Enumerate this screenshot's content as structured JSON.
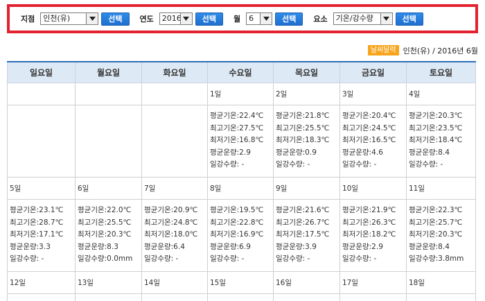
{
  "filters": {
    "station_label": "지점",
    "station_value": "인천(유)",
    "year_label": "연도",
    "year_value": "2016",
    "month_label": "월",
    "month_value": "6",
    "element_label": "요소",
    "element_value": "기온/강수량",
    "select_button": "선택"
  },
  "legend": {
    "badge": "날씨달력",
    "caption": "인천(유) / 2016년 6월"
  },
  "colors": {
    "highlight_border": "#e3222f",
    "button_blue": "#1f6fcf",
    "header_bg": "#dde9f4",
    "header_top_border": "#2a6db8",
    "badge_orange": "#f7a51c"
  },
  "calendar": {
    "weekdays": [
      "일요일",
      "월요일",
      "화요일",
      "수요일",
      "목요일",
      "금요일",
      "토요일"
    ],
    "weeks": [
      {
        "dates": [
          "",
          "",
          "",
          "1일",
          "2일",
          "3일",
          "4일"
        ],
        "stats": [
          null,
          null,
          null,
          [
            "평균기온:22.4℃",
            "최고기온:27.5℃",
            "최저기온:16.8℃",
            "평균운량:2.9",
            "일강수량: -"
          ],
          [
            "평균기온:21.8℃",
            "최고기온:25.5℃",
            "최저기온:18.3℃",
            "평균운량:0.9",
            "일강수량: -"
          ],
          [
            "평균기온:20.4℃",
            "최고기온:24.5℃",
            "최저기온:16.5℃",
            "평균운량:4.6",
            "일강수량: -"
          ],
          [
            "평균기온:20.3℃",
            "최고기온:23.5℃",
            "최저기온:18.4℃",
            "평균운량:8.4",
            "일강수량: -"
          ]
        ]
      },
      {
        "dates": [
          "5일",
          "6일",
          "7일",
          "8일",
          "9일",
          "10일",
          "11일"
        ],
        "stats": [
          [
            "평균기온:23.1℃",
            "최고기온:28.7℃",
            "최저기온:17.1℃",
            "평균운량:3.3",
            "일강수량: -"
          ],
          [
            "평균기온:22.0℃",
            "최고기온:25.5℃",
            "최저기온:20.3℃",
            "평균운량:8.3",
            "일강수량:0.0mm"
          ],
          [
            "평균기온:20.9℃",
            "최고기온:24.8℃",
            "최저기온:18.0℃",
            "평균운량:6.4",
            "일강수량: -"
          ],
          [
            "평균기온:19.5℃",
            "최고기온:22.8℃",
            "최저기온:16.9℃",
            "평균운량:6.9",
            "일강수량: -"
          ],
          [
            "평균기온:21.6℃",
            "최고기온:26.7℃",
            "최저기온:17.5℃",
            "평균운량:3.9",
            "일강수량: -"
          ],
          [
            "평균기온:21.9℃",
            "최고기온:26.3℃",
            "최저기온:18.2℃",
            "평균운량:2.9",
            "일강수량: -"
          ],
          [
            "평균기온:22.3℃",
            "최고기온:25.7℃",
            "최저기온:20.3℃",
            "평균운량:8.4",
            "일강수량:3.8mm"
          ]
        ]
      },
      {
        "dates": [
          "12일",
          "13일",
          "14일",
          "15일",
          "16일",
          "17일",
          "18일"
        ],
        "stats": null
      }
    ]
  }
}
